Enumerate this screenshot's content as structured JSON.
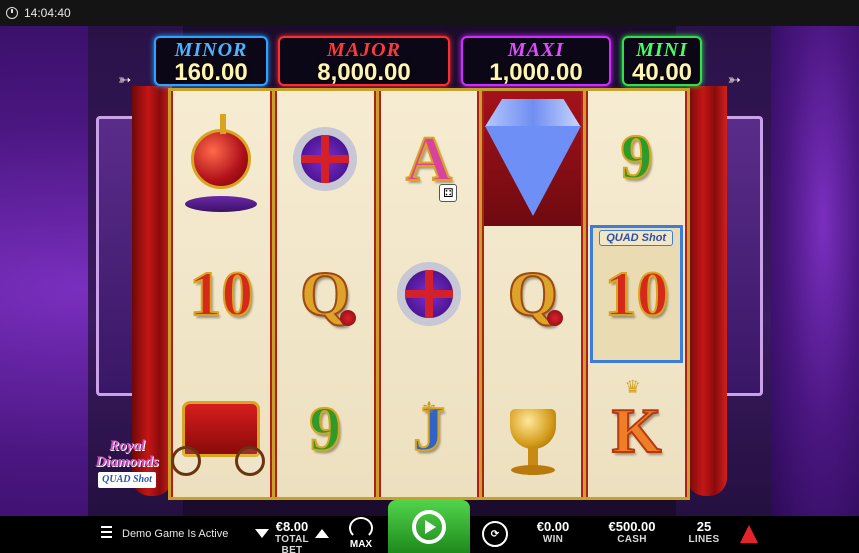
{
  "statusbar": {
    "time": "14:04:40"
  },
  "jackpots": {
    "minor": {
      "label": "MINOR",
      "value": "160.00"
    },
    "major": {
      "label": "MAJOR",
      "value": "8,000.00"
    },
    "maxi": {
      "label": "MAXI",
      "value": "1,000.00"
    },
    "mini": {
      "label": "MINI",
      "value": "40.00"
    }
  },
  "reels": {
    "r1": [
      "orb",
      "10",
      "carriage"
    ],
    "r2": [
      "ring",
      "Q",
      "9"
    ],
    "r3": [
      "A",
      "ring",
      "J"
    ],
    "r4": [
      "diamond",
      "Q",
      "chalice"
    ],
    "r5": [
      "9",
      "10",
      "K"
    ],
    "labels": {
      "ten": "10",
      "nine": "9",
      "queen": "Q",
      "ace": "A",
      "jack": "J",
      "king": "K"
    },
    "quad_badge": "QUAD Shot"
  },
  "logo": {
    "line1": "Royal",
    "line2": "Diamonds",
    "line3": "QUAD Shot"
  },
  "controls": {
    "demo_text": "Demo Game Is Active",
    "total_bet_value": "€8.00",
    "total_bet_label": "TOTAL BET",
    "max_label": "MAX",
    "win_value": "€0.00",
    "win_label": "WIN",
    "cash_value": "€500.00",
    "cash_label": "CASH",
    "lines_value": "25",
    "lines_label": "LINES"
  },
  "colors": {
    "spin_green": "#2fb52a",
    "minor": "#2aa4ff",
    "major": "#ff2d2d",
    "maxi": "#d22bff",
    "mini": "#2ee04a"
  }
}
